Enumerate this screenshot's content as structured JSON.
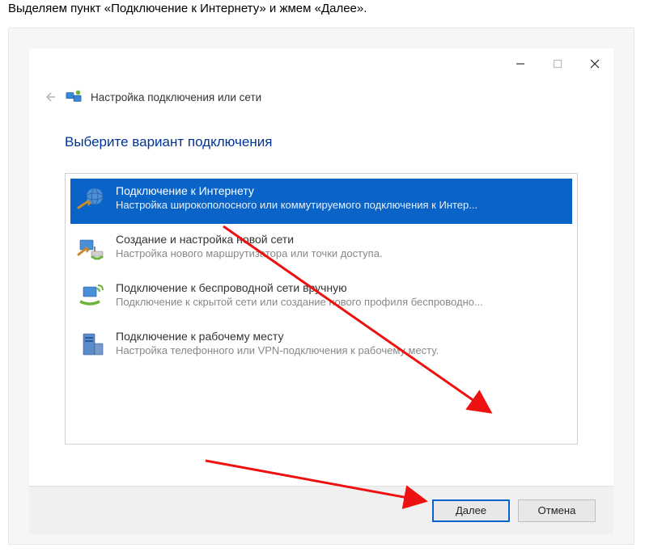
{
  "caption": "Выделяем пункт «Подключение к Интернету» и жмем «Далее».",
  "header": {
    "title": "Настройка подключения или сети"
  },
  "heading": "Выберите вариант подключения",
  "options": [
    {
      "title": "Подключение к Интернету",
      "sub": "Настройка широкополосного или коммутируемого подключения к Интер..."
    },
    {
      "title": "Создание и настройка новой сети",
      "sub": "Настройка нового маршрутизатора или точки доступа."
    },
    {
      "title": "Подключение к беспроводной сети вручную",
      "sub": "Подключение к скрытой сети или создание нового профиля беспроводно..."
    },
    {
      "title": "Подключение к рабочему месту",
      "sub": "Настройка телефонного или VPN-подключения к рабочему месту."
    }
  ],
  "buttons": {
    "next": "Далее",
    "cancel": "Отмена"
  }
}
